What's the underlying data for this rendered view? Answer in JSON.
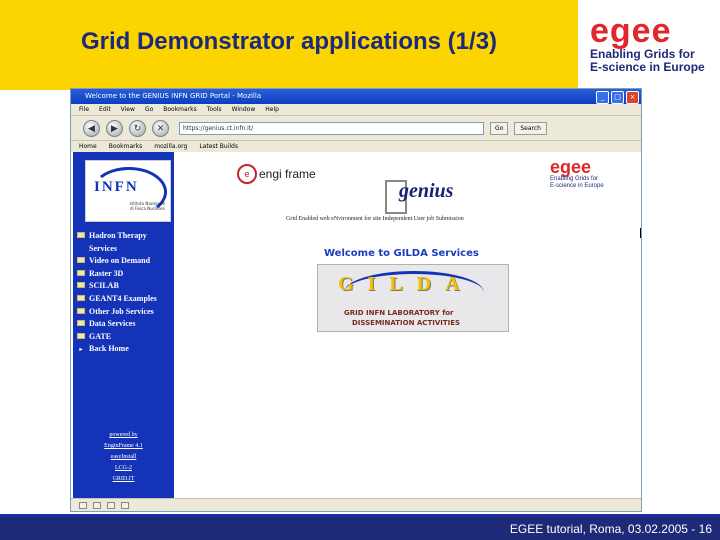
{
  "slide": {
    "title": "Grid Demonstrator applications (1/3)",
    "footer": "EGEE tutorial, Roma, 03.02.2005 - 16",
    "colors": {
      "title_band": "#fcd400",
      "title_text": "#1d2a78",
      "footer_bar": "#1d2a78"
    }
  },
  "logo": {
    "word": "egee",
    "tagline_1": "Enabling Grids for",
    "tagline_2": "E-science in Europe"
  },
  "browser": {
    "window_title": "Welcome to the GENIUS INFN GRID Portal - Mozilla",
    "menu": [
      "File",
      "Edit",
      "View",
      "Go",
      "Bookmarks",
      "Tools",
      "Window",
      "Help"
    ],
    "url": "https://genius.ct.infn.it/",
    "go_label": "Go",
    "search_label": "Search",
    "bookmarks": [
      "Home",
      "Bookmarks",
      "mozilla.org",
      "Latest Builds"
    ],
    "window_buttons": [
      "_",
      "□",
      "×"
    ]
  },
  "page": {
    "infn_logo_text": "INFN",
    "infn_logo_sub": "Istituto Nazionale di Fisica Nucleare",
    "menu_items": [
      {
        "label": "Hadron Therapy",
        "icon": "folder-icon"
      },
      {
        "label": "Services",
        "icon": ""
      },
      {
        "label": "Video on Demand",
        "icon": "folder-icon"
      },
      {
        "label": "Raster 3D",
        "icon": "folder-icon"
      },
      {
        "label": "SCILAB",
        "icon": "folder-icon"
      },
      {
        "label": "GEANT4 Examples",
        "icon": "folder-icon"
      },
      {
        "label": "Other Job Services",
        "icon": "folder-icon"
      },
      {
        "label": "Data Services",
        "icon": "folder-icon"
      },
      {
        "label": "GATE",
        "icon": "folder-icon"
      },
      {
        "label": "Back Home",
        "icon": "arrow-icon"
      }
    ],
    "powered_by": [
      "powered by",
      "EnginFrame 4.1",
      "easyInstall",
      "LCG-2",
      "GRID.IT"
    ],
    "enginframe_text": "engi frame",
    "genius_text": "genius",
    "egee_small": {
      "word": "egee",
      "tag_1": "Enabling Grids for",
      "tag_2": "E-science in Europe"
    },
    "top_nav": "Grid Enabled web eNvironment for site Independent User job Submission",
    "welcome": "Welcome to GILDA Services",
    "gilda_letters": "GILDA",
    "gilda_line_1": "GRID INFN LABORATORY for",
    "gilda_line_2": "DISSEMINATION ACTIVITIES"
  }
}
